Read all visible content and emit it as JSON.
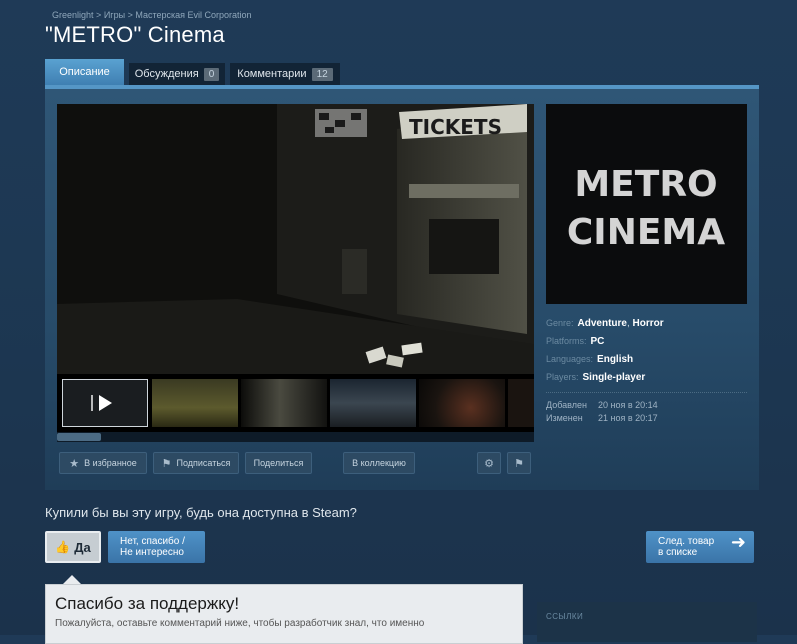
{
  "breadcrumb": {
    "items": [
      "Greenlight",
      "Игры",
      "Мастерская Evil Corporation"
    ],
    "separator": ">"
  },
  "title": "\"METRO\" Cinema",
  "tabs": [
    {
      "label": "Описание",
      "active": true
    },
    {
      "label": "Обсуждения",
      "count": "0"
    },
    {
      "label": "Комментарии",
      "count": "12"
    }
  ],
  "media": {
    "screenshot_sign": "TICKETS",
    "scroll_fraction": 0.09
  },
  "actions": {
    "favorite": "В избранное",
    "subscribe": "Подписаться",
    "share": "Поделиться",
    "collection": "В коллекцию",
    "settings_icon": "gear-icon",
    "flag_icon": "flag-icon"
  },
  "capsule": {
    "line1": "METRO",
    "line2": "CINEMA"
  },
  "details": {
    "genre_label": "Genre:",
    "genre_values": [
      "Adventure",
      "Horror"
    ],
    "platforms_label": "Platforms:",
    "platforms_value": "PC",
    "languages_label": "Languages:",
    "languages_value": "English",
    "players_label": "Players:",
    "players_value": "Single-player",
    "added_label": "Добавлен",
    "added_value": "20 ноя в 20:14",
    "updated_label": "Изменен",
    "updated_value": "21 ноя в 20:17"
  },
  "vote": {
    "question": "Купили бы вы эту игру, будь она доступна в Steam?",
    "yes": "Да",
    "no_line1": "Нет, спасибо /",
    "no_line2": "Не интересно",
    "next_line1": "След. товар",
    "next_line2": "в списке"
  },
  "thanks": {
    "title": "Спасибо за поддержку!",
    "body": "Пожалуйста, оставьте комментарий ниже, чтобы разработчик знал, что именно"
  },
  "links": {
    "title": "ССЫЛКИ"
  },
  "colors": {
    "accent": "#5596c6",
    "background": "#1d3853",
    "vote_blue": "#3f82b9"
  }
}
